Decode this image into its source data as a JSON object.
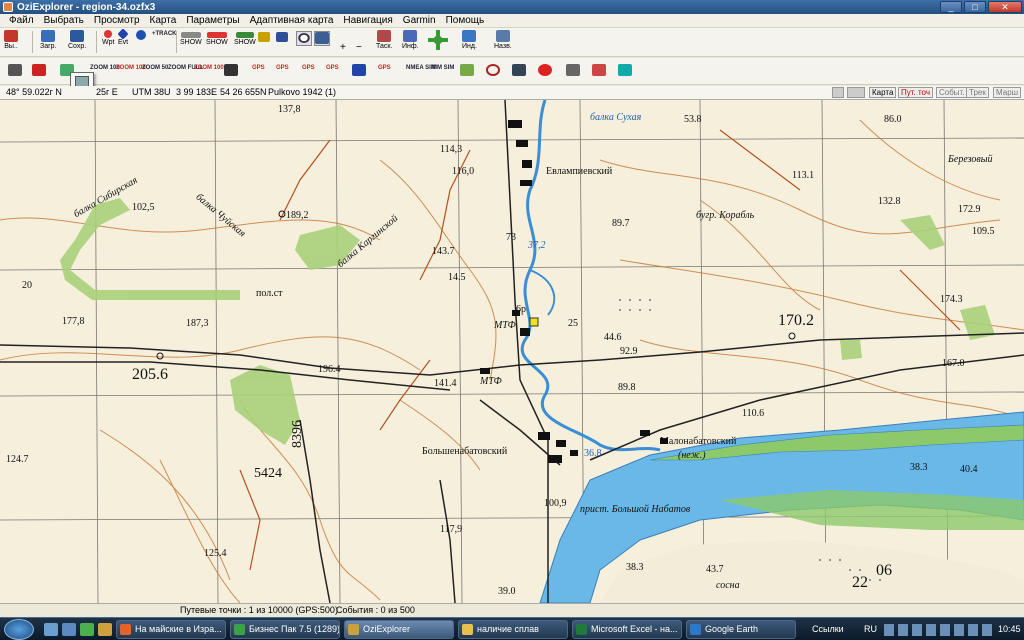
{
  "window": {
    "title": "OziExplorer - region-34.ozfx3",
    "min": "_",
    "max": "□",
    "close": "✕"
  },
  "menu": [
    "Файл",
    "Выбрать",
    "Просмотр",
    "Карта",
    "Параметры",
    "Адаптивная карта",
    "Навигация",
    "Garmin",
    "Помощь"
  ],
  "toolbar1": {
    "exit_label": "Вы..",
    "load_label": "Загр.",
    "save_label": "Сохр.",
    "wpt_label": "Wpt",
    "evt_label": "Evt",
    "track_label": "+TRACK",
    "show_label": "SHOW",
    "zoom_value": "100",
    "plus": "+",
    "minus": "−",
    "task_label": "Таск.",
    "info_label": "Инф.",
    "ind_label": "Инд.",
    "nav_label": "Назв."
  },
  "toolbar2": {
    "zooms": [
      "ZOOM 100",
      "ZOOM 100",
      "ZOOM 50",
      "ZOOM FULL",
      "ZOOM 100"
    ],
    "gps_label": "GPS",
    "nmea_label": "NMEA SIM",
    "mm_label": "MM SIM"
  },
  "infobar": {
    "lat": "48° 59.022г N",
    "lon": "25г E",
    "utm_zone": "UTM  38U",
    "easting": "3 99 183E",
    "northing": "54 26 655N",
    "datum": "Pulkovo 1942 (1)",
    "tabs": [
      "Карта",
      "Пут. точ",
      "Событ.",
      "Трек",
      "Марш"
    ]
  },
  "map": {
    "labels": [
      "137,8",
      "балка Сухая",
      "53.8",
      "86.0",
      "114,3",
      "116,0",
      "Евлампиевский",
      "Березовый",
      "113.1",
      "балка Сибирская",
      "102,5",
      "189,2",
      "балка Чуйская",
      "132.8",
      "балка Каргинской",
      "172.9",
      "109.5",
      "89.7",
      "бугр. Корабль",
      "143.7",
      "73",
      "37,2",
      "пол.ст",
      "177,8",
      "187,3",
      "174.3",
      "МТФ",
      "170.2",
      "205.6",
      "6р",
      "44.6",
      "92.9",
      "196.4",
      "167.0",
      "141.4",
      "МТФ",
      "89.8",
      "110.6",
      "8396",
      "Малонабатовский",
      "Большенабатовский",
      "(неж.)",
      "124.7",
      "36.8",
      "38.3",
      "40.4",
      "5424",
      "100,9",
      "прист. Большой Набатов",
      "117,9",
      "125.4",
      "38.3",
      "43.7",
      "39.0",
      "сосна",
      "22",
      "06",
      "25",
      "20",
      "14.5"
    ]
  },
  "status": {
    "waypoints": "Путевые точки : 1 из 10000  (GPS:500)",
    "events": "События : 0 из 500"
  },
  "taskbar": {
    "tasks": [
      {
        "label": "На майские в Изра...",
        "color": "#e2642b"
      },
      {
        "label": "Бизнес Пак 7.5 (1289)",
        "color": "#3ca14a"
      },
      {
        "label": "OziExplorer",
        "color": "#c8a33a"
      },
      {
        "label": "наличие сплав",
        "color": "#e6c14b"
      },
      {
        "label": "Microsoft Excel - на...",
        "color": "#1e7b3a"
      },
      {
        "label": "Google Earth",
        "color": "#2d78c8"
      }
    ],
    "links": "Ссылки",
    "lang": "RU",
    "clock": "10:45"
  }
}
